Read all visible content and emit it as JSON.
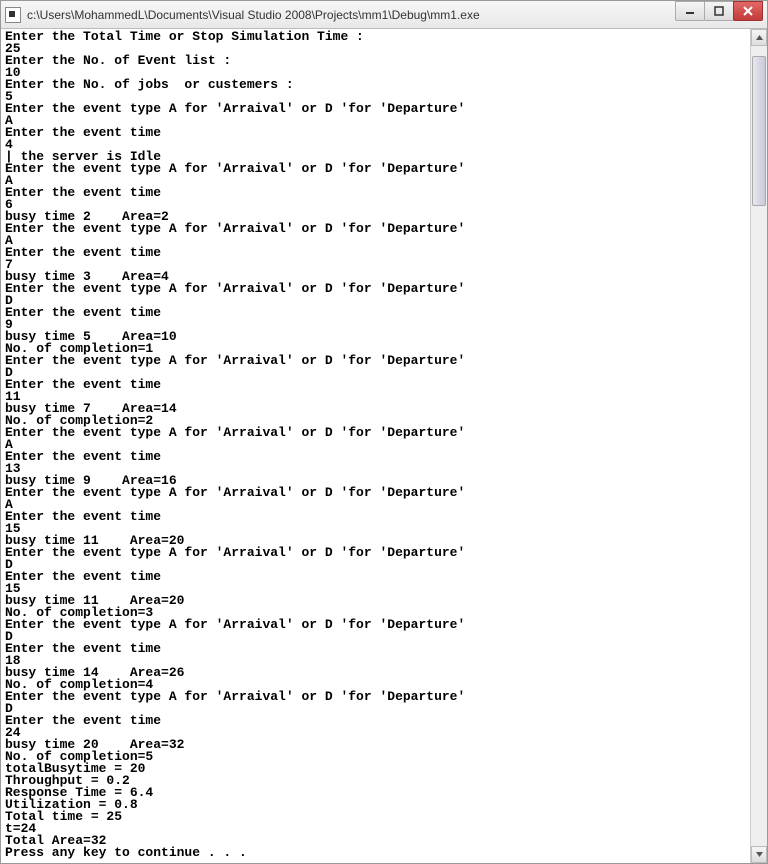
{
  "window": {
    "title": "c:\\Users\\MohammedL\\Documents\\Visual Studio 2008\\Projects\\mm1\\Debug\\mm1.exe"
  },
  "console": {
    "lines": [
      "Enter the Total Time or Stop Simulation Time :",
      "25",
      "Enter the No. of Event list :",
      "10",
      "Enter the No. of jobs  or custemers :",
      "5",
      "Enter the event type A for 'Arraival' or D 'for 'Departure'",
      "A",
      "Enter the event time",
      "4",
      "| the server is Idle",
      "Enter the event type A for 'Arraival' or D 'for 'Departure'",
      "A",
      "Enter the event time",
      "6",
      "busy time 2    Area=2",
      "Enter the event type A for 'Arraival' or D 'for 'Departure'",
      "A",
      "Enter the event time",
      "7",
      "busy time 3    Area=4",
      "Enter the event type A for 'Arraival' or D 'for 'Departure'",
      "D",
      "Enter the event time",
      "9",
      "busy time 5    Area=10",
      "No. of completion=1",
      "Enter the event type A for 'Arraival' or D 'for 'Departure'",
      "D",
      "Enter the event time",
      "11",
      "busy time 7    Area=14",
      "No. of completion=2",
      "Enter the event type A for 'Arraival' or D 'for 'Departure'",
      "A",
      "Enter the event time",
      "13",
      "busy time 9    Area=16",
      "Enter the event type A for 'Arraival' or D 'for 'Departure'",
      "A",
      "Enter the event time",
      "15",
      "busy time 11    Area=20",
      "Enter the event type A for 'Arraival' or D 'for 'Departure'",
      "D",
      "Enter the event time",
      "15",
      "busy time 11    Area=20",
      "No. of completion=3",
      "Enter the event type A for 'Arraival' or D 'for 'Departure'",
      "D",
      "Enter the event time",
      "18",
      "busy time 14    Area=26",
      "No. of completion=4",
      "Enter the event type A for 'Arraival' or D 'for 'Departure'",
      "D",
      "Enter the event time",
      "24",
      "busy time 20    Area=32",
      "No. of completion=5",
      "totalBusytime = 20",
      "Throughput = 0.2",
      "Response Time = 6.4",
      "Utilization = 0.8",
      "Total time = 25",
      "t=24",
      "Total Area=32",
      "Press any key to continue . . ."
    ]
  }
}
